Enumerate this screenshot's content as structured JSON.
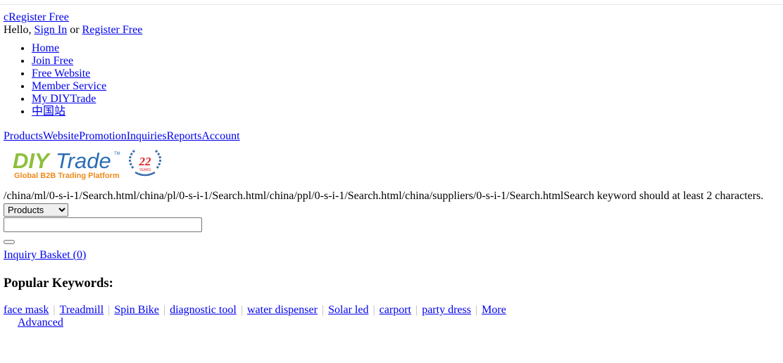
{
  "top_bar": {
    "register_link": "cRegister Free",
    "greeting": "Hello,",
    "sign_in": "Sign In",
    "or": "or",
    "register": "Register Free"
  },
  "nav": {
    "items": [
      {
        "label": "Home"
      },
      {
        "label": "Join Free"
      },
      {
        "label": "Free Website"
      },
      {
        "label": "Member Service"
      },
      {
        "label": "My DIYTrade"
      },
      {
        "label": "中国站"
      }
    ]
  },
  "account_tabs": {
    "items": [
      {
        "label": "Products"
      },
      {
        "label": "Website"
      },
      {
        "label": "Promotion"
      },
      {
        "label": "Inquiries"
      },
      {
        "label": "Reports"
      },
      {
        "label": "Account"
      }
    ]
  },
  "logo": {
    "brand_diy": "DIY",
    "brand_trade": "Trade",
    "tm": "TM",
    "tagline": "Global B2B Trading Platform",
    "badge_number": "22",
    "badge_years": "YEARS"
  },
  "search": {
    "paths_text": "/china/ml/0-s-i-1/Search.html/china/pl/0-s-i-1/Search.html/china/ppl/0-s-i-1/Search.html/china/suppliers/0-s-i-1/Search.html",
    "validation_msg": "Search keyword should at least 2 characters.",
    "category_selected": "Products",
    "keyword_value": ""
  },
  "inquiry_basket": "Inquiry Basket (0)",
  "popular": {
    "heading": "Popular Keywords:",
    "keywords": [
      {
        "label": "face mask"
      },
      {
        "label": "Treadmill"
      },
      {
        "label": "Spin Bike"
      },
      {
        "label": "diagnostic tool"
      },
      {
        "label": "water dispenser"
      },
      {
        "label": "Solar led"
      },
      {
        "label": "carport"
      },
      {
        "label": "party dress"
      }
    ],
    "more": "More",
    "advanced": "Advanced"
  },
  "colors": {
    "link": "#0000ee",
    "brand_green": "#8dbf3c",
    "brand_blue": "#2a6db5",
    "tagline_orange": "#f08a1c",
    "badge_red": "#e0262b",
    "badge_blue": "#3a6fb0"
  }
}
